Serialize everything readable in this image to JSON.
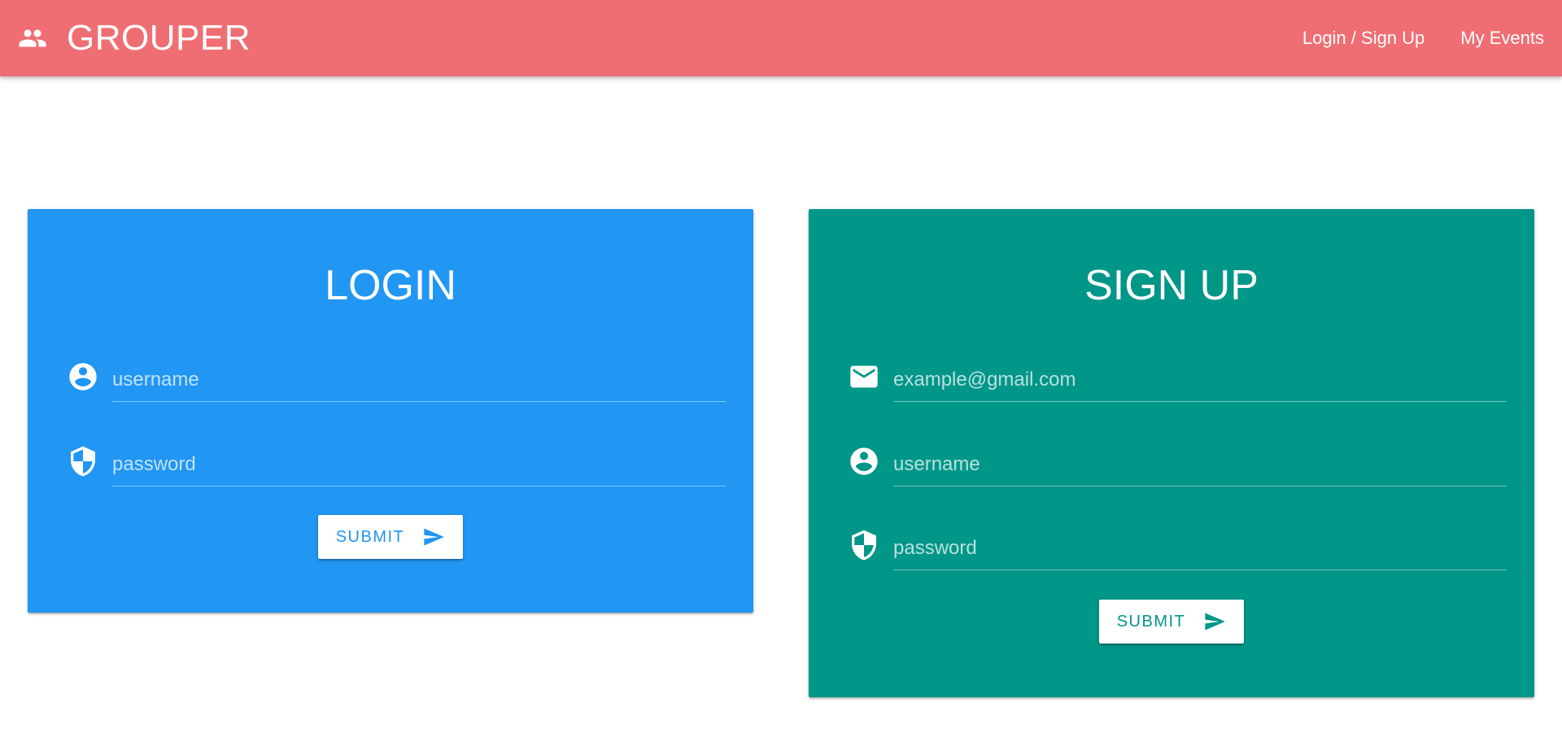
{
  "app": {
    "title": "GROUPER",
    "brand_icon": "people-icon"
  },
  "nav": {
    "links": [
      {
        "label": "Login / Sign Up"
      },
      {
        "label": "My Events"
      }
    ]
  },
  "colors": {
    "navbar": "#ef6e73",
    "login_card": "#2196f3",
    "signup_card": "#009688",
    "button_bg": "#ffffff"
  },
  "login": {
    "title": "LOGIN",
    "fields": [
      {
        "icon": "account-circle-icon",
        "placeholder": "username",
        "value": ""
      },
      {
        "icon": "shield-icon",
        "placeholder": "password",
        "value": ""
      }
    ],
    "submit_label": "SUBMIT",
    "submit_icon": "send-icon"
  },
  "signup": {
    "title": "SIGN UP",
    "fields": [
      {
        "icon": "email-icon",
        "placeholder": "example@gmail.com",
        "value": ""
      },
      {
        "icon": "account-circle-icon",
        "placeholder": "username",
        "value": ""
      },
      {
        "icon": "shield-icon",
        "placeholder": "password",
        "value": ""
      }
    ],
    "submit_label": "SUBMIT",
    "submit_icon": "send-icon"
  }
}
